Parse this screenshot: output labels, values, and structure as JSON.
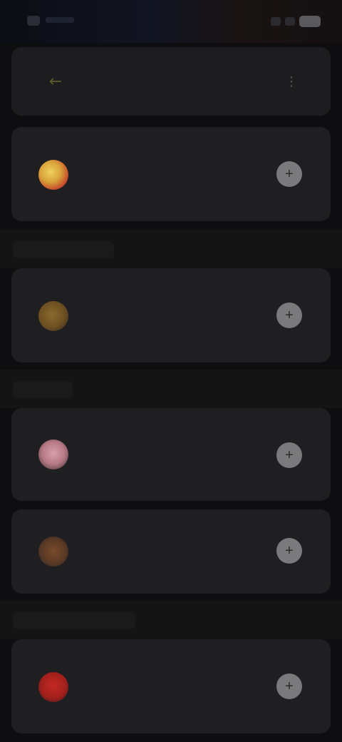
{
  "header": {
    "title": "",
    "back_glyph": "←",
    "menu_glyph": "⋮"
  },
  "sections": [
    {
      "label": ""
    },
    {
      "label": ""
    },
    {
      "label": ""
    }
  ],
  "items": [
    {
      "line1": "",
      "line2": "",
      "meta": "",
      "icon": "app-icon-yellow-orange",
      "color": "#d9a33a",
      "button_glyph": "+"
    },
    {
      "line1": "",
      "line2": "",
      "meta": "",
      "icon": "app-icon-brown",
      "color": "#6d4f22",
      "button_glyph": "+"
    },
    {
      "line1": "",
      "line2": "",
      "meta": "",
      "icon": "app-icon-pink",
      "color": "#b77a86",
      "button_glyph": "+"
    },
    {
      "line1": "",
      "line2": "",
      "meta": "",
      "icon": "app-icon-dark-orange",
      "color": "#5a3a25",
      "button_glyph": "+"
    },
    {
      "line1": "",
      "line2": "",
      "meta": "",
      "icon": "app-icon-red",
      "color": "#a3201c",
      "button_glyph": "+"
    }
  ],
  "status_bar": {
    "battery": ""
  }
}
